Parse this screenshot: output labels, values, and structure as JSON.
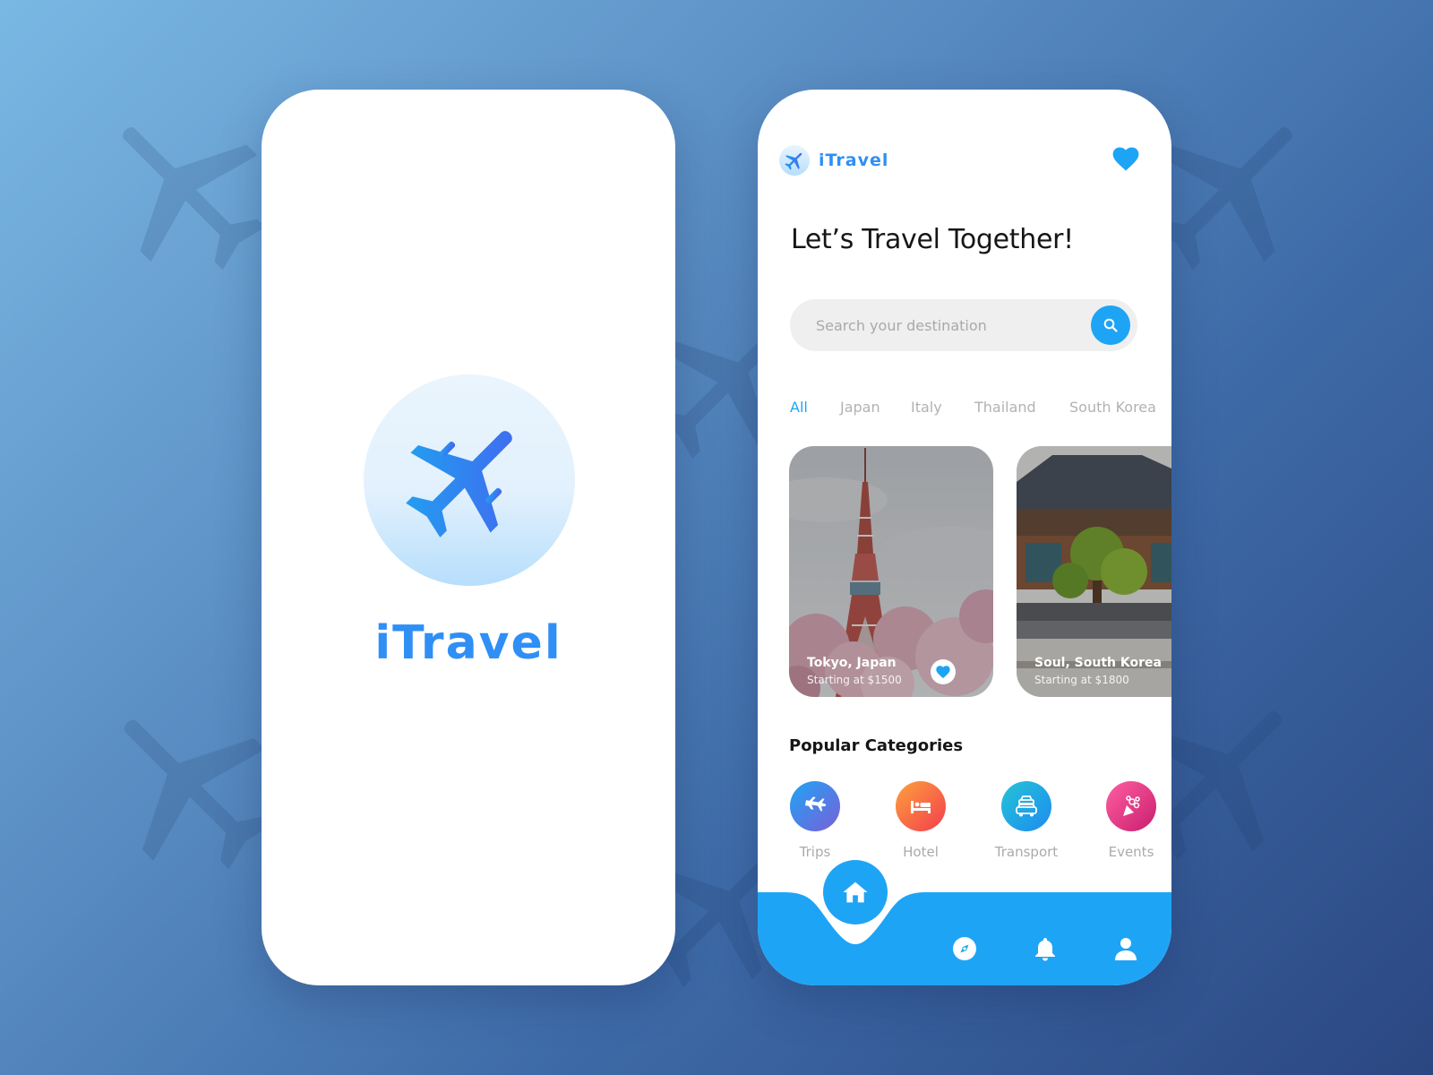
{
  "splash": {
    "app_name": "iTravel"
  },
  "home": {
    "brand_name": "iTravel",
    "headline": "Let’s Travel Together!",
    "search": {
      "placeholder": "Search your destination"
    },
    "tabs": [
      {
        "label": "All",
        "active": true
      },
      {
        "label": "Japan",
        "active": false
      },
      {
        "label": "Italy",
        "active": false
      },
      {
        "label": "Thailand",
        "active": false
      },
      {
        "label": "South Korea",
        "active": false
      }
    ],
    "destinations": [
      {
        "title": "Tokyo, Japan",
        "price": "Starting at $1500",
        "favorite": true
      },
      {
        "title": "Soul, South Korea",
        "price": "Starting at $1800",
        "favorite": false
      }
    ],
    "section_title": "Popular Categories",
    "categories": [
      {
        "label": "Trips",
        "icon": "airplane-icon"
      },
      {
        "label": "Hotel",
        "icon": "bed-icon"
      },
      {
        "label": "Transport",
        "icon": "car-icon"
      },
      {
        "label": "Events",
        "icon": "flower-bouquet-icon"
      }
    ],
    "nav": [
      {
        "icon": "home-icon",
        "active": true
      },
      {
        "icon": "compass-icon",
        "active": false
      },
      {
        "icon": "bell-icon",
        "active": false
      },
      {
        "icon": "user-icon",
        "active": false
      }
    ]
  },
  "colors": {
    "primary": "#1ea4f5",
    "brand_text": "#2f8ff5",
    "background_start": "#7ab8e4",
    "background_end": "#2b4782"
  }
}
